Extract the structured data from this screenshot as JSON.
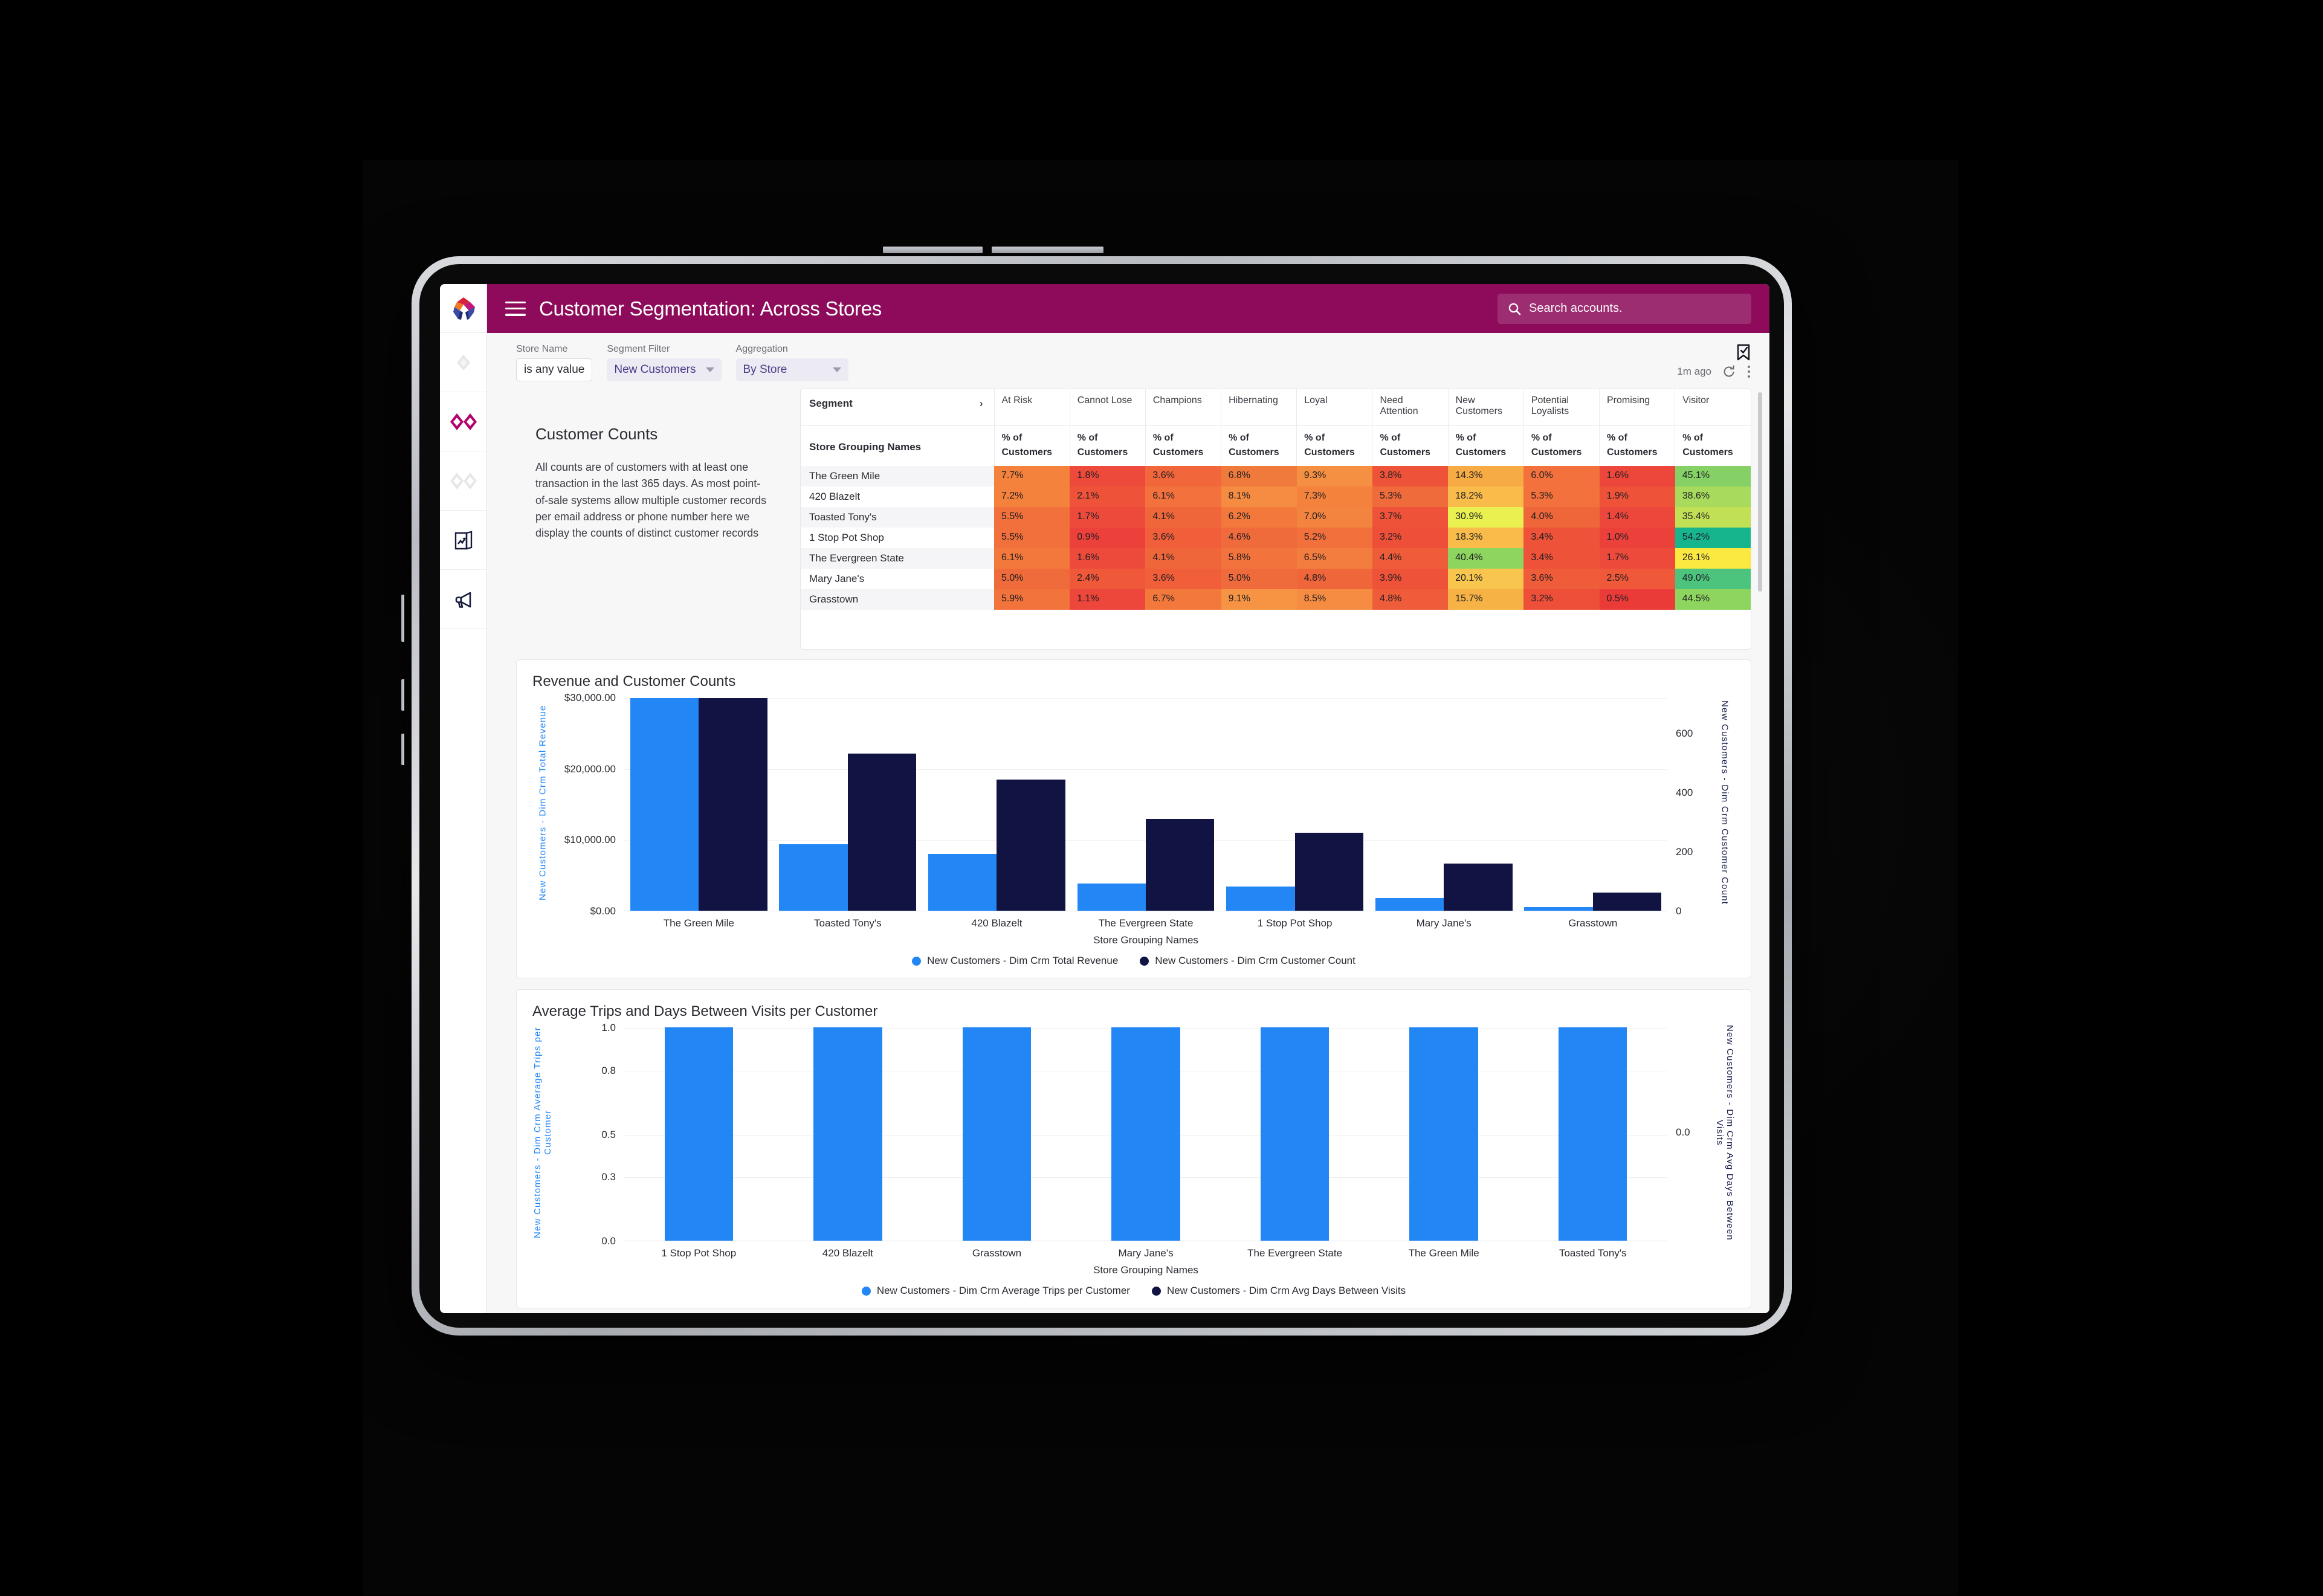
{
  "app": {
    "title": "Customer Segmentation: Across Stores",
    "logo_icon": "arch-logo-icon",
    "menu_icon": "hamburger-menu-icon",
    "brand_color": "#8d0b5a"
  },
  "search": {
    "placeholder": "Search accounts.",
    "icon": "search-icon"
  },
  "rail": {
    "items": [
      {
        "name": "diamond-icon",
        "icon": "diamond-icon",
        "active": false
      },
      {
        "name": "double-diamond-icon",
        "icon": "double-diamond-icon",
        "active": true
      },
      {
        "name": "double-diamond-faded-icon",
        "icon": "double-diamond-faded-icon",
        "active": false
      },
      {
        "name": "report-trend-icon",
        "icon": "report-trend-icon",
        "active": false
      },
      {
        "name": "megaphone-icon",
        "icon": "megaphone-icon",
        "active": false
      }
    ]
  },
  "filters": [
    {
      "label": "Store Name",
      "value": "is any value",
      "type": "text"
    },
    {
      "label": "Segment Filter",
      "value": "New Customers",
      "type": "select"
    },
    {
      "label": "Aggregation",
      "value": "By Store",
      "type": "select"
    }
  ],
  "toolbar": {
    "bookmark_icon": "bookmark-check-icon",
    "updated": "1m ago",
    "refresh_icon": "refresh-icon",
    "more_icon": "more-vertical-icon"
  },
  "description": {
    "title": "Customer Counts",
    "body": "All counts are of customers with at least one transaction in the last 365 days. As most point-of-sale systems allow multiple customer records per email address or phone number here we display the counts of distinct customer records"
  },
  "table": {
    "segment_header": "Segment",
    "row_header": "Store Grouping Names",
    "expand_icon": "chevron-right-icon",
    "segments": [
      "At Risk",
      "Cannot Lose",
      "Champions",
      "Hibernating",
      "Loyal",
      "Need Attention",
      "New Customers",
      "Potential Loyalists",
      "Promising",
      "Visitor"
    ],
    "measure": "% of Customers",
    "rows": [
      {
        "name": "The Green Mile",
        "values": [
          "7.7%",
          "1.8%",
          "3.6%",
          "6.8%",
          "9.3%",
          "3.8%",
          "14.3%",
          "6.0%",
          "1.6%",
          "45.1%"
        ],
        "colors": [
          "#f4823c",
          "#ee4a3c",
          "#f2663b",
          "#f07a3c",
          "#f59043",
          "#ee5239",
          "#f7ab44",
          "#f2713c",
          "#ed463a",
          "#85d166"
        ]
      },
      {
        "name": "420 Blazelt",
        "values": [
          "7.2%",
          "2.1%",
          "6.1%",
          "8.1%",
          "7.3%",
          "5.3%",
          "18.2%",
          "5.3%",
          "1.9%",
          "38.6%"
        ],
        "colors": [
          "#f4823c",
          "#ee5239",
          "#f2713c",
          "#f58c41",
          "#f4823c",
          "#f06b3b",
          "#f9bb4a",
          "#f2713c",
          "#ee5239",
          "#a8da5e"
        ]
      },
      {
        "name": "Toasted Tony's",
        "values": [
          "5.5%",
          "1.7%",
          "4.1%",
          "6.2%",
          "7.0%",
          "3.7%",
          "30.9%",
          "4.0%",
          "1.4%",
          "35.4%"
        ],
        "colors": [
          "#f1703c",
          "#ee4a3c",
          "#f0663b",
          "#f2783c",
          "#f38440",
          "#ee5239",
          "#e9f04f",
          "#f0663b",
          "#ed463a",
          "#c1e055"
        ]
      },
      {
        "name": "1 Stop Pot Shop",
        "values": [
          "5.5%",
          "0.9%",
          "3.6%",
          "4.6%",
          "5.2%",
          "3.2%",
          "18.3%",
          "3.4%",
          "1.0%",
          "54.2%"
        ],
        "colors": [
          "#f1703c",
          "#ec413b",
          "#f05f3a",
          "#f06b3b",
          "#f1703c",
          "#ee4f38",
          "#f9bb4a",
          "#ee5239",
          "#ec413b",
          "#17b58e"
        ]
      },
      {
        "name": "The Evergreen State",
        "values": [
          "6.1%",
          "1.6%",
          "4.1%",
          "5.8%",
          "6.5%",
          "4.4%",
          "40.4%",
          "3.4%",
          "1.7%",
          "26.1%"
        ],
        "colors": [
          "#f2783c",
          "#ee4a3c",
          "#f0663b",
          "#f2733c",
          "#f37d3e",
          "#ef5c3a",
          "#8ed55f",
          "#ee5239",
          "#ee4a3c",
          "#fbe942"
        ]
      },
      {
        "name": "Mary Jane's",
        "values": [
          "5.0%",
          "2.4%",
          "3.6%",
          "5.0%",
          "4.8%",
          "3.9%",
          "20.1%",
          "3.6%",
          "2.5%",
          "49.0%"
        ],
        "colors": [
          "#f06b3b",
          "#ef5838",
          "#f05f3a",
          "#f06b3b",
          "#f0663b",
          "#ee5239",
          "#f8c64f",
          "#ef5c3a",
          "#ef5838",
          "#4cc47e"
        ]
      },
      {
        "name": "Grasstown",
        "values": [
          "5.9%",
          "1.1%",
          "6.7%",
          "9.1%",
          "8.5%",
          "4.8%",
          "15.7%",
          "3.2%",
          "0.5%",
          "44.5%"
        ],
        "colors": [
          "#f2733c",
          "#ed463a",
          "#f2783c",
          "#f79444",
          "#f58c41",
          "#ef5c3a",
          "#f7b246",
          "#ee4f38",
          "#eb3b39",
          "#8ed55f"
        ]
      }
    ]
  },
  "chart_data": [
    {
      "type": "bar",
      "title": "Revenue and Customer Counts",
      "xlabel": "Store Grouping Names",
      "categories": [
        "The Green Mile",
        "Toasted Tony's",
        "420 Blazelt",
        "The Evergreen State",
        "1 Stop Pot Shop",
        "Mary Jane's",
        "Grasstown"
      ],
      "series": [
        {
          "name": "New Customers - Dim Crm Total Revenue",
          "color": "#2286f5",
          "axis": "left",
          "values": [
            34900,
            10900,
            9300,
            4500,
            4000,
            2100,
            600
          ]
        },
        {
          "name": "New Customers - Dim Crm Customer Count",
          "color": "#111442",
          "axis": "right",
          "values": [
            718,
            530,
            443,
            310,
            263,
            160,
            62
          ]
        }
      ],
      "ylabel": "New Customers - Dim Crm Total Revenue",
      "yticks": [
        "$0.00",
        "$10,000.00",
        "$20,000.00",
        "$30,000.00"
      ],
      "ylim": [
        0,
        35000
      ],
      "y2label": "New Customers - Dim Crm Customer Count",
      "y2ticks": [
        "0",
        "200",
        "400",
        "600"
      ],
      "y2lim": [
        0,
        720
      ],
      "grid": true,
      "legend_position": "bottom"
    },
    {
      "type": "bar",
      "title": "Average Trips and Days Between Visits per Customer",
      "xlabel": "Store Grouping Names",
      "categories": [
        "1 Stop Pot Shop",
        "420 Blazelt",
        "Grasstown",
        "Mary Jane's",
        "The Evergreen State",
        "The Green Mile",
        "Toasted Tony's"
      ],
      "series": [
        {
          "name": "New Customers - Dim Crm Average Trips per Customer",
          "color": "#2286f5",
          "axis": "left",
          "values": [
            1.0,
            1.0,
            1.0,
            1.0,
            1.0,
            1.0,
            1.0
          ]
        },
        {
          "name": "New Customers - Dim Crm Avg Days Between Visits",
          "color": "#111442",
          "axis": "right",
          "values": [
            0.0,
            0.0,
            0.0,
            0.0,
            0.0,
            0.0,
            0.0
          ]
        }
      ],
      "ylabel": "New Customers - Dim Crm Average Trips per Customer",
      "yticks": [
        "0.0",
        "0.3",
        "0.5",
        "0.8",
        "1.0"
      ],
      "ylim": [
        0,
        1
      ],
      "y2label": "New Customers - Dim Crm Avg Days Between Visits",
      "y2ticks": [
        "0.0"
      ],
      "y2lim": [
        0,
        1
      ],
      "grid": true,
      "legend_position": "bottom"
    }
  ]
}
